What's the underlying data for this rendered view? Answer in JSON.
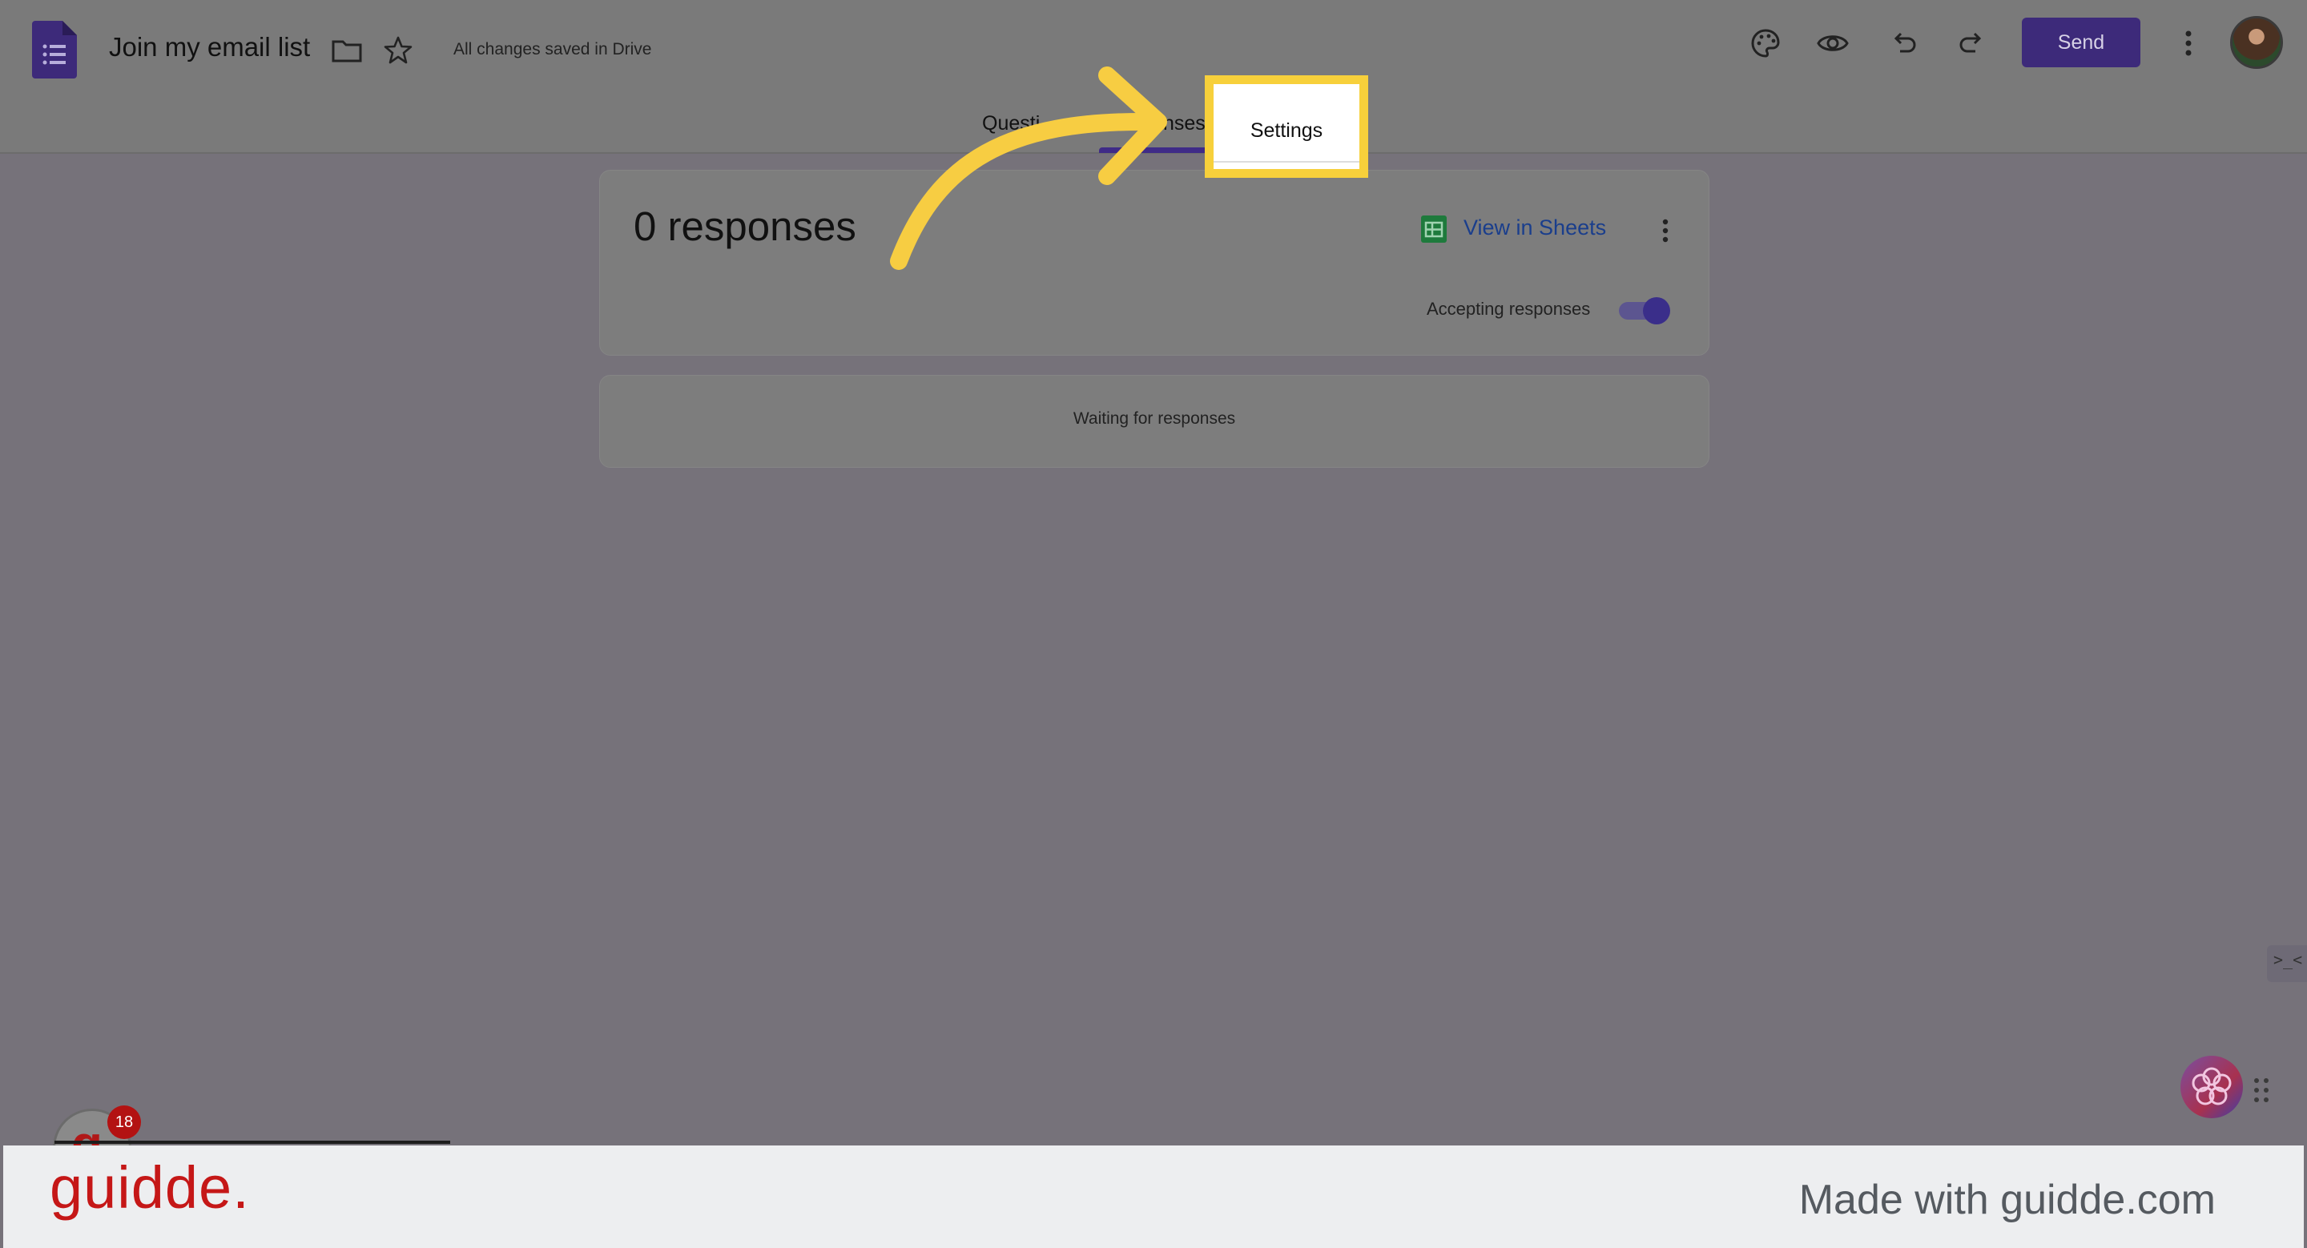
{
  "header": {
    "title": "Join my email list",
    "save_status": "All changes saved in Drive",
    "send_label": "Send"
  },
  "tabs": {
    "questions_partial": "Questi",
    "responses_partial": "nses",
    "settings": "Settings",
    "active": "Responses"
  },
  "responses_card": {
    "count_text": "0 responses",
    "view_in_sheets": "View in Sheets",
    "accepting_label": "Accepting responses",
    "accepting_on": true
  },
  "waiting_card": {
    "text": "Waiting for responses"
  },
  "widgets": {
    "notification_count": "18",
    "collapse_glyph": ">_<"
  },
  "footer": {
    "logo": "guidde.",
    "tagline": "Made with guidde.com"
  },
  "colors": {
    "highlight": "#f7d03b",
    "arrow": "#f7cd42",
    "accent": "#3f2b87",
    "brand_red": "#c51717"
  },
  "icons": [
    "forms-logo-icon",
    "folder-icon",
    "star-icon",
    "palette-icon",
    "eye-icon",
    "undo-icon",
    "redo-icon",
    "more-vert-icon",
    "sheets-icon",
    "flower-icon",
    "grip-icon"
  ]
}
